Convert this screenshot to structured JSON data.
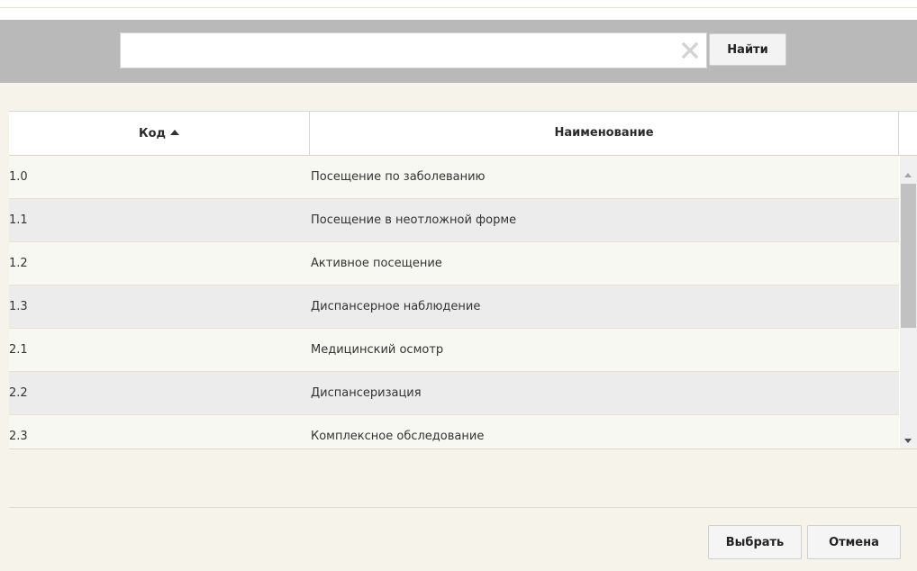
{
  "search": {
    "value": "",
    "placeholder": "",
    "clear_icon": "close-x-icon",
    "button_label": "Найти"
  },
  "table": {
    "columns": [
      {
        "label": "Код",
        "sort": "ascending",
        "sort_icon": "sort-ascending-caret-icon"
      },
      {
        "label": "Наименование"
      }
    ],
    "rows": [
      {
        "code": "1.0",
        "name": "Посещение по заболеванию"
      },
      {
        "code": "1.1",
        "name": "Посещение в неотложной форме"
      },
      {
        "code": "1.2",
        "name": "Активное посещение"
      },
      {
        "code": "1.3",
        "name": "Диспансерное наблюдение"
      },
      {
        "code": "2.1",
        "name": "Медицинский осмотр"
      },
      {
        "code": "2.2",
        "name": "Диспансеризация"
      },
      {
        "code": "2.3",
        "name": "Комплексное обследование"
      }
    ]
  },
  "footer": {
    "select_label": "Выбрать",
    "cancel_label": "Отмена"
  },
  "colors": {
    "toolbar_bg": "#b9b9b9",
    "dialog_bg": "#f6f4ea",
    "row_alt": "#ececec",
    "row_base": "#f8f8f2"
  }
}
